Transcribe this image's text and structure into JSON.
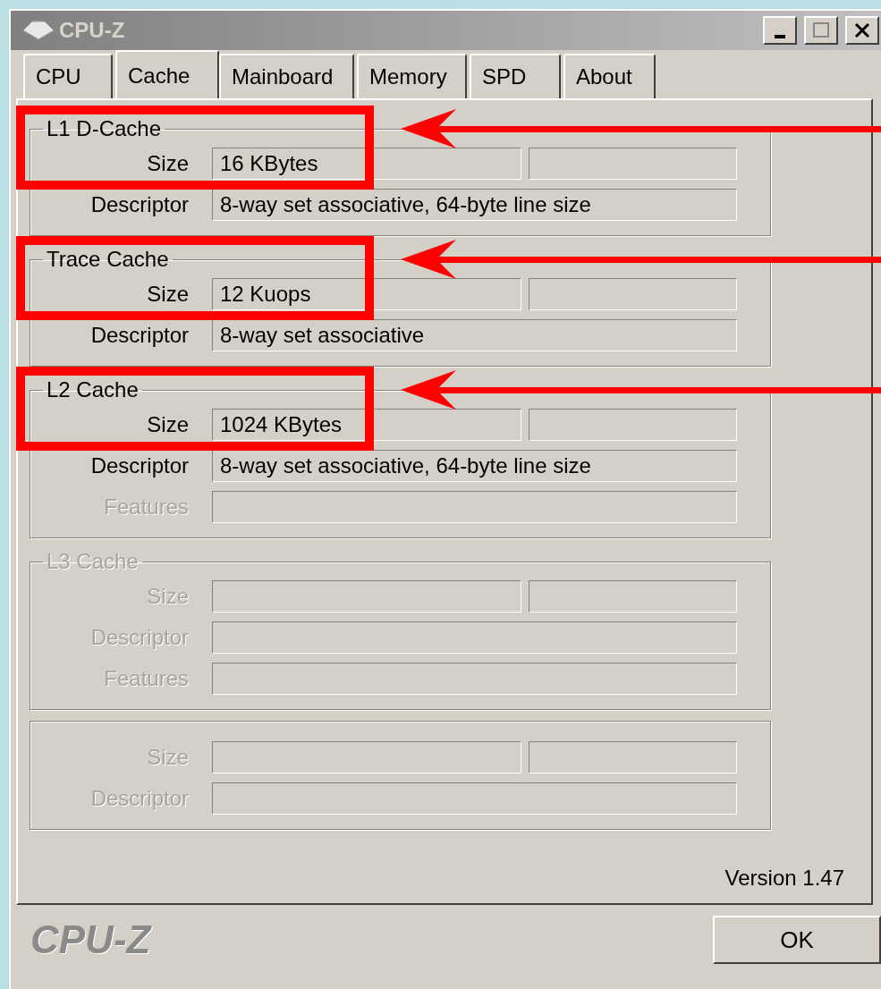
{
  "window": {
    "title": "CPU-Z"
  },
  "tabs": [
    {
      "label": "CPU",
      "selected": false
    },
    {
      "label": "Cache",
      "selected": true
    },
    {
      "label": "Mainboard",
      "selected": false
    },
    {
      "label": "Memory",
      "selected": false
    },
    {
      "label": "SPD",
      "selected": false
    },
    {
      "label": "About",
      "selected": false
    }
  ],
  "sections": [
    {
      "title": "L1 D-Cache",
      "disabled": false,
      "highlighted": true,
      "rows": [
        {
          "kind": "pair",
          "label": "Size",
          "value": "16 KBytes",
          "disabled": false
        },
        {
          "kind": "wide",
          "label": "Descriptor",
          "value": "8-way set associative, 64-byte line size",
          "disabled": false
        }
      ]
    },
    {
      "title": "Trace Cache",
      "disabled": false,
      "highlighted": true,
      "rows": [
        {
          "kind": "pair",
          "label": "Size",
          "value": "12 Kuops",
          "disabled": false
        },
        {
          "kind": "wide",
          "label": "Descriptor",
          "value": "8-way set associative",
          "disabled": false
        }
      ]
    },
    {
      "title": "L2 Cache",
      "disabled": false,
      "highlighted": true,
      "rows": [
        {
          "kind": "pair",
          "label": "Size",
          "value": "1024 KBytes",
          "disabled": false
        },
        {
          "kind": "wide",
          "label": "Descriptor",
          "value": "8-way set associative, 64-byte line size",
          "disabled": false
        },
        {
          "kind": "wide",
          "label": "Features",
          "disabled": true
        }
      ]
    },
    {
      "title": "L3 Cache",
      "disabled": true,
      "highlighted": false,
      "rows": [
        {
          "kind": "pair",
          "label": "Size",
          "disabled": true
        },
        {
          "kind": "wide",
          "label": "Descriptor",
          "disabled": true
        },
        {
          "kind": "wide",
          "label": "Features",
          "disabled": true
        }
      ]
    },
    {
      "rows": [
        {
          "kind": "pair",
          "label": "Size",
          "disabled": true
        },
        {
          "kind": "wide",
          "label": "Descriptor",
          "disabled": true
        }
      ]
    }
  ],
  "version": "Version 1.47",
  "brand": "CPU-Z",
  "ok_button": "OK"
}
